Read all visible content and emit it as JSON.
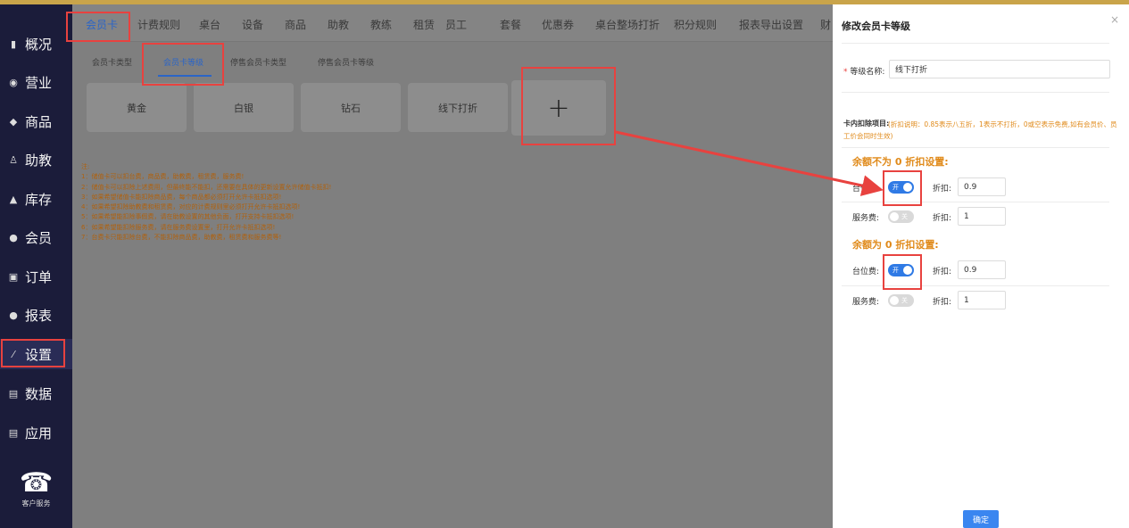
{
  "sidebar": {
    "items": [
      {
        "icon": "bar-chart-icon",
        "label": "概况"
      },
      {
        "icon": "circle-icon",
        "label": "营业"
      },
      {
        "icon": "goods-icon",
        "label": "商品"
      },
      {
        "icon": "person-icon",
        "label": "助教"
      },
      {
        "icon": "warehouse-icon",
        "label": "库存"
      },
      {
        "icon": "member-icon",
        "label": "会员"
      },
      {
        "icon": "order-icon",
        "label": "订单"
      },
      {
        "icon": "report-icon",
        "label": "报表"
      },
      {
        "icon": "wand-icon",
        "label": "设置"
      },
      {
        "icon": "data-icon",
        "label": "数据"
      },
      {
        "icon": "app-icon",
        "label": "应用"
      }
    ],
    "customer_service": "客户服务"
  },
  "nav": {
    "tabs": [
      "会员卡",
      "计费规则",
      "桌台",
      "设备",
      "商品",
      "助教",
      "教练",
      "租赁",
      "员工",
      "套餐",
      "优惠券",
      "桌台整场打折",
      "积分规则",
      "报表导出设置",
      "财"
    ],
    "active": "会员卡"
  },
  "subnav": {
    "tabs": [
      "会员卡类型",
      "会员卡等级",
      "停售会员卡类型",
      "停售会员卡等级"
    ],
    "active": "会员卡等级"
  },
  "levels": [
    "黄金",
    "白银",
    "钻石",
    "线下打折"
  ],
  "add_symbol": "+",
  "notes": {
    "title": "注:",
    "lines": [
      "1：储值卡可以扣台费，商品费，助教费，租赁费，服务费!",
      "2：储值卡可以扣除上述费用，但最终能不能扣，还需要在具体的更新设置允许储值卡抵扣!",
      "3：如果希望储值卡能扣除商品费，每个商品都必须打开允许卡抵扣选项!",
      "4：如果希望扣除助教费和租赁费，对应的计费规则里必须打开允许卡抵扣选项!",
      "5：如果希望能扣除事假费，请在助教设置的其他负面，打开支持卡抵扣选项!",
      "6：如果希望能扣除服务费，请在服务费设置里，打开允许卡抵扣选项!",
      "7：台费卡只能扣除台费，不能扣除商品费，助教费，租赁费和服务费等!"
    ]
  },
  "panel": {
    "title": "修改会员卡等级",
    "close": "×",
    "name_label": "等级名称:",
    "name_required": "*",
    "name_value": "线下打折",
    "deduct_label": "卡内扣除项目:",
    "deduct_note": "(折扣说明：0.85表示八五折，1表示不打折，0或空表示免费,如有会员价、员工价会同时生效)",
    "section1": {
      "title": "余额不为 0 折扣设置:",
      "rows": [
        {
          "label": "台位费:",
          "toggle_text": "开",
          "on": true,
          "discount_label": "折扣:",
          "discount": "0.9"
        },
        {
          "label": "服务费:",
          "toggle_text": "关",
          "on": false,
          "discount_label": "折扣:",
          "discount": "1"
        }
      ]
    },
    "section2": {
      "title": "余额为 0 折扣设置:",
      "rows": [
        {
          "label": "台位费:",
          "toggle_text": "开",
          "on": true,
          "discount_label": "折扣:",
          "discount": "0.9"
        },
        {
          "label": "服务费:",
          "toggle_text": "关",
          "on": false,
          "discount_label": "折扣:",
          "discount": "1"
        }
      ]
    },
    "confirm": "确定"
  },
  "colors": {
    "sidebar_bg": "#1b1c3a",
    "accent": "#2b65c7",
    "annotation_red": "#e8423f",
    "warning_orange": "#e08a1a",
    "toggle_on": "#2f7ae5"
  }
}
